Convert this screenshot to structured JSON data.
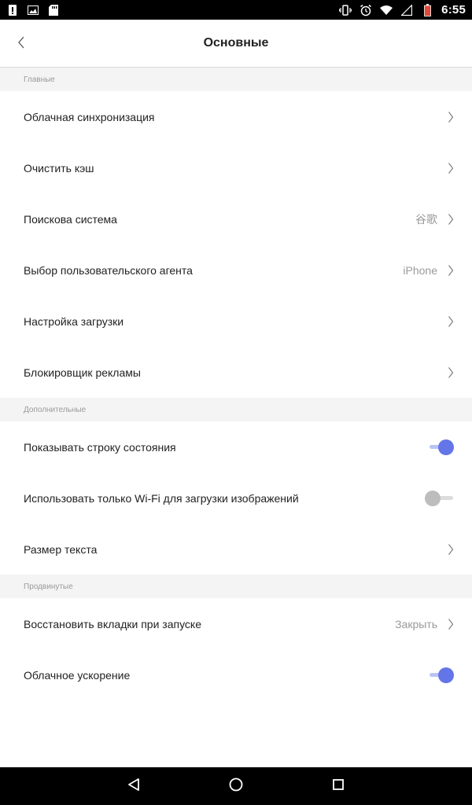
{
  "status_bar": {
    "time": "6:55",
    "icons_left": [
      "alert-icon",
      "image-icon",
      "sd-card-icon"
    ],
    "icons_right": [
      "vibrate-icon",
      "alarm-icon",
      "wifi-icon",
      "signal-icon",
      "battery-icon"
    ]
  },
  "header": {
    "title": "Основные"
  },
  "sections": {
    "main": {
      "title": "Главные",
      "items": [
        {
          "label": "Облачная синхронизация"
        },
        {
          "label": "Очистить кэш"
        },
        {
          "label": "Поискова система",
          "value": "谷歌"
        },
        {
          "label": "Выбор пользовательского агента",
          "value": "iPhone"
        },
        {
          "label": "Настройка загрузки"
        },
        {
          "label": "Блокировщик рекламы"
        }
      ]
    },
    "extra": {
      "title": "Дополнительные",
      "items": [
        {
          "label": "Показывать строку состояния",
          "toggle": true
        },
        {
          "label": "Использовать только Wi-Fi для загрузки изображений",
          "toggle": false
        },
        {
          "label": "Размер текста"
        }
      ]
    },
    "advanced": {
      "title": "Продвинутые",
      "items": [
        {
          "label": "Восстановить вкладки при запуске",
          "value": "Закрыть"
        },
        {
          "label": "Облачное ускорение",
          "toggle": true
        }
      ]
    }
  },
  "colors": {
    "accent": "#6475e8",
    "accent_track": "#b9c4f4",
    "section_bg": "#f4f4f4",
    "muted_text": "#9a9a9a"
  }
}
